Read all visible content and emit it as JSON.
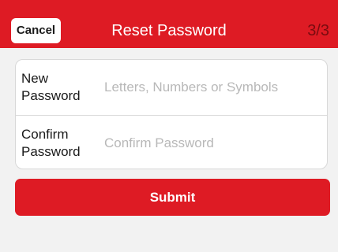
{
  "header": {
    "cancel_label": "Cancel",
    "title": "Reset Password",
    "step": "3/3"
  },
  "form": {
    "new_password": {
      "label": "New\nPassword",
      "placeholder": "Letters, Numbers or Symbols",
      "value": ""
    },
    "confirm_password": {
      "label": "Confirm\nPassword",
      "placeholder": "Confirm Password",
      "value": ""
    }
  },
  "submit_label": "Submit",
  "colors": {
    "accent": "#de1b24",
    "background": "#f2f2f2",
    "step_text": "#7a0c10"
  }
}
